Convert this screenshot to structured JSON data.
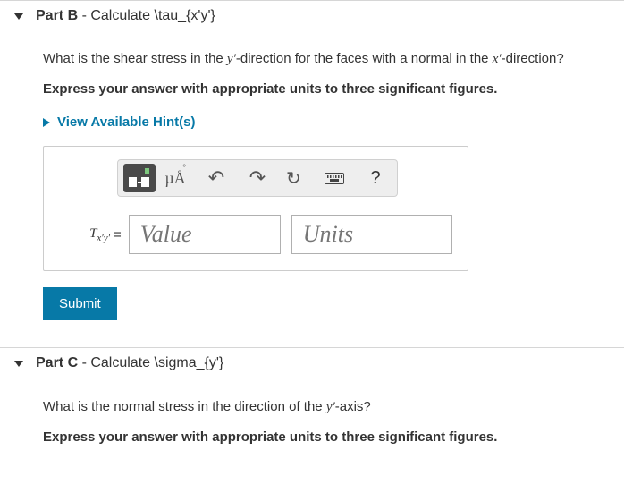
{
  "partB": {
    "label": "Part B",
    "dash": " - ",
    "subtitle": "Calculate \\tau_{x'y'}",
    "question_pre": "What is the shear stress in the ",
    "question_var1": "y′",
    "question_mid": "-direction for the faces with a normal in the ",
    "question_var2": "x′",
    "question_post": "-direction?",
    "instruction": "Express your answer with appropriate units to three significant figures.",
    "hints": "View Available Hint(s)",
    "var_symbol": "τx′y′",
    "value_placeholder": "Value",
    "units_placeholder": "Units",
    "submit": "Submit",
    "toolbar": {
      "templates": "templates",
      "mu": "µÅ",
      "undo": "↶",
      "redo": "↷",
      "reset": "↺",
      "keyboard": "keyboard",
      "help": "?"
    }
  },
  "partC": {
    "label": "Part C",
    "dash": " - ",
    "subtitle": "Calculate \\sigma_{y'}",
    "question_pre": "What is the normal stress in the direction of the ",
    "question_var1": "y′",
    "question_post": "-axis?",
    "instruction": "Express your answer with appropriate units to three significant figures."
  }
}
